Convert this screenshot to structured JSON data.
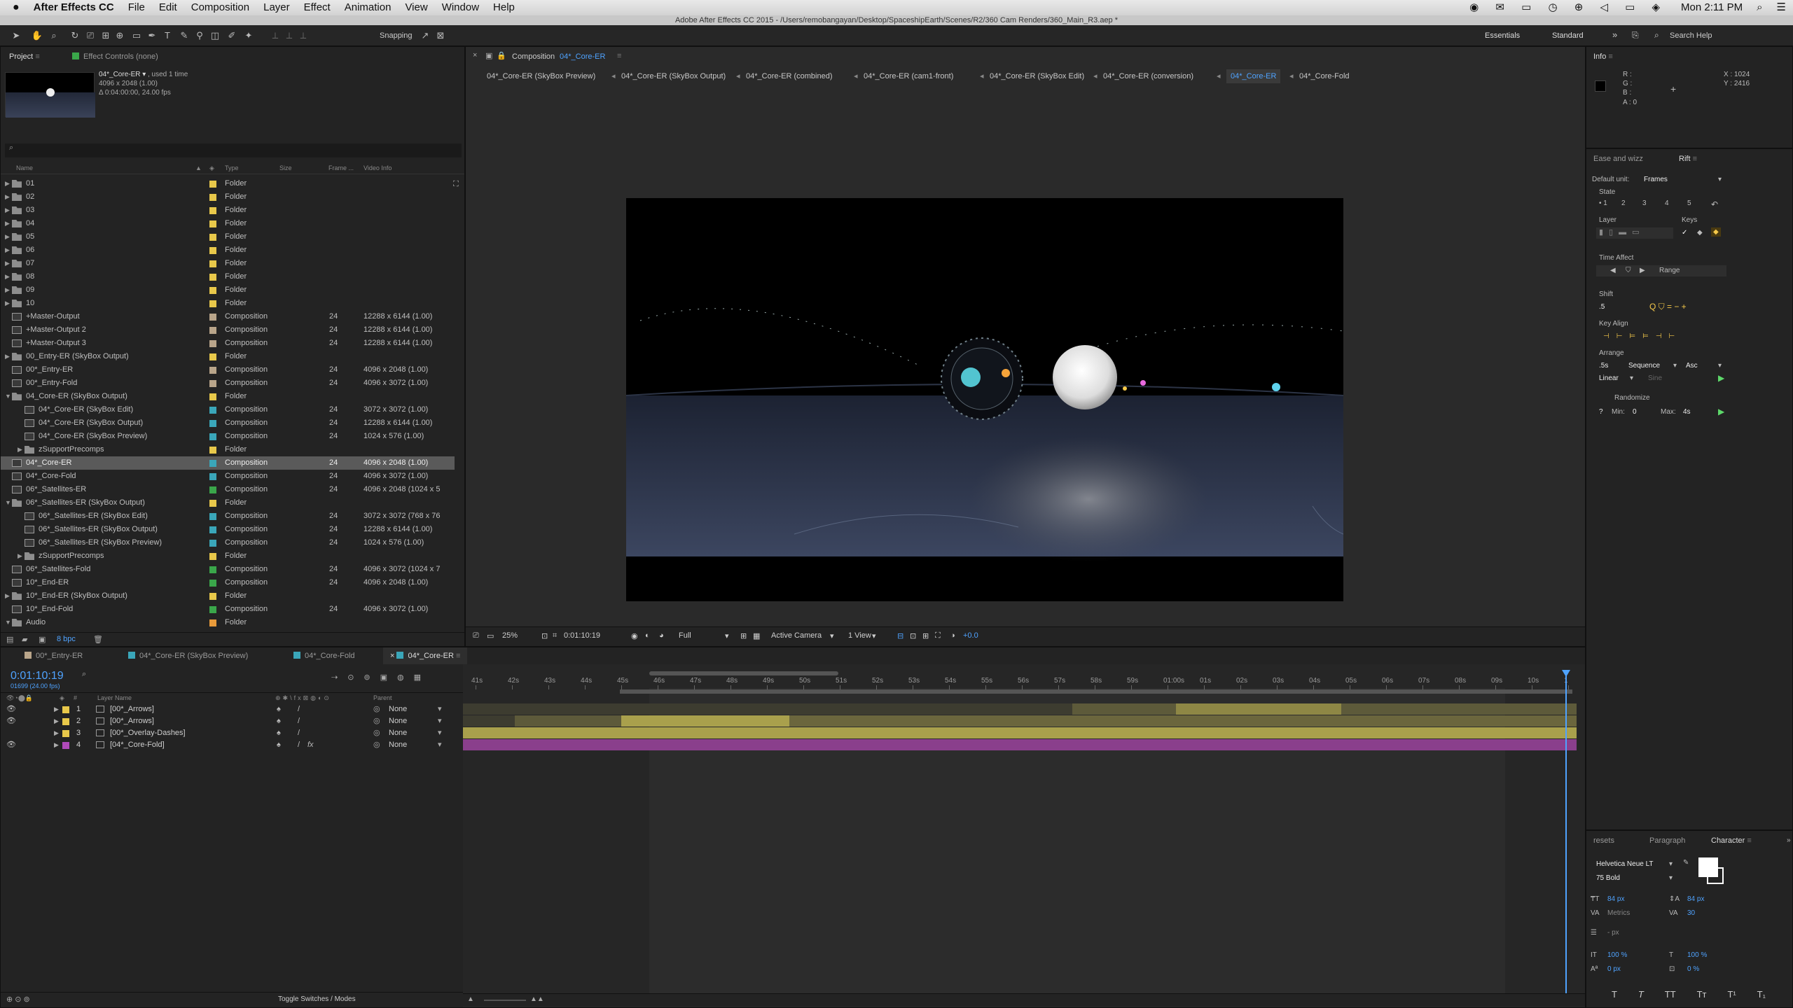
{
  "menubar": {
    "apple": "",
    "app": "After Effects CC",
    "items": [
      "File",
      "Edit",
      "Composition",
      "Layer",
      "Effect",
      "Animation",
      "View",
      "Window",
      "Help"
    ],
    "clock": "Mon 2:11 PM"
  },
  "title": "Adobe After Effects CC 2015 - /Users/remobangayan/Desktop/SpaceshipEarth/Scenes/R2/360 Cam Renders/360_Main_R3.aep *",
  "toolbar": {
    "snapping": "Snapping",
    "workspaces": [
      "Essentials",
      "Standard"
    ],
    "search": "Search Help"
  },
  "project": {
    "tab": "Project",
    "tab2": "Effect Controls (none)",
    "thumb_name": "04*_Core-ER ▾",
    "thumb_used": ", used 1 time",
    "thumb_size": "4096 x 2048 (1.00)",
    "thumb_dur": "Δ 0:04:00:00, 24.00 fps",
    "columns": [
      "Name",
      "Type",
      "Size",
      "Frame ...",
      "Video Info"
    ],
    "bpc": "8 bpc",
    "items": [
      {
        "tw": "▶",
        "name": "01",
        "type": "Folder",
        "fr": "",
        "vi": "",
        "color": "#e8c84a",
        "kind": "folder",
        "ind": 0
      },
      {
        "tw": "▶",
        "name": "02",
        "type": "Folder",
        "fr": "",
        "vi": "",
        "color": "#e8c84a",
        "kind": "folder",
        "ind": 0
      },
      {
        "tw": "▶",
        "name": "03",
        "type": "Folder",
        "fr": "",
        "vi": "",
        "color": "#e8c84a",
        "kind": "folder",
        "ind": 0
      },
      {
        "tw": "▶",
        "name": "04",
        "type": "Folder",
        "fr": "",
        "vi": "",
        "color": "#e8c84a",
        "kind": "folder",
        "ind": 0
      },
      {
        "tw": "▶",
        "name": "05",
        "type": "Folder",
        "fr": "",
        "vi": "",
        "color": "#e8c84a",
        "kind": "folder",
        "ind": 0
      },
      {
        "tw": "▶",
        "name": "06",
        "type": "Folder",
        "fr": "",
        "vi": "",
        "color": "#e8c84a",
        "kind": "folder",
        "ind": 0
      },
      {
        "tw": "▶",
        "name": "07",
        "type": "Folder",
        "fr": "",
        "vi": "",
        "color": "#e8c84a",
        "kind": "folder",
        "ind": 0
      },
      {
        "tw": "▶",
        "name": "08",
        "type": "Folder",
        "fr": "",
        "vi": "",
        "color": "#e8c84a",
        "kind": "folder",
        "ind": 0
      },
      {
        "tw": "▶",
        "name": "09",
        "type": "Folder",
        "fr": "",
        "vi": "",
        "color": "#e8c84a",
        "kind": "folder",
        "ind": 0
      },
      {
        "tw": "▶",
        "name": "10",
        "type": "Folder",
        "fr": "",
        "vi": "",
        "color": "#e8c84a",
        "kind": "folder",
        "ind": 0
      },
      {
        "tw": "",
        "name": "+Master-Output",
        "type": "Composition",
        "fr": "24",
        "vi": "12288 x 6144 (1.00)",
        "color": "#b9a58a",
        "kind": "comp",
        "ind": 0
      },
      {
        "tw": "",
        "name": "+Master-Output 2",
        "type": "Composition",
        "fr": "24",
        "vi": "12288 x 6144 (1.00)",
        "color": "#b9a58a",
        "kind": "comp",
        "ind": 0
      },
      {
        "tw": "",
        "name": "+Master-Output 3",
        "type": "Composition",
        "fr": "24",
        "vi": "12288 x 6144 (1.00)",
        "color": "#b9a58a",
        "kind": "comp",
        "ind": 0
      },
      {
        "tw": "▶",
        "name": "00_Entry-ER (SkyBox Output)",
        "type": "Folder",
        "fr": "",
        "vi": "",
        "color": "#e8c84a",
        "kind": "folder",
        "ind": 0
      },
      {
        "tw": "",
        "name": "00*_Entry-ER",
        "type": "Composition",
        "fr": "24",
        "vi": "4096 x 2048 (1.00)",
        "color": "#b9a58a",
        "kind": "comp",
        "ind": 0
      },
      {
        "tw": "",
        "name": "00*_Entry-Fold",
        "type": "Composition",
        "fr": "24",
        "vi": "4096 x 3072 (1.00)",
        "color": "#b9a58a",
        "kind": "comp",
        "ind": 0
      },
      {
        "tw": "▼",
        "name": "04_Core-ER (SkyBox Output)",
        "type": "Folder",
        "fr": "",
        "vi": "",
        "color": "#e8c84a",
        "kind": "folder",
        "ind": 0
      },
      {
        "tw": "",
        "name": "04*_Core-ER (SkyBox Edit)",
        "type": "Composition",
        "fr": "24",
        "vi": "3072 x 3072 (1.00)",
        "color": "#3aa6b9",
        "kind": "comp",
        "ind": 1
      },
      {
        "tw": "",
        "name": "04*_Core-ER (SkyBox Output)",
        "type": "Composition",
        "fr": "24",
        "vi": "12288 x 6144 (1.00)",
        "color": "#3aa6b9",
        "kind": "comp",
        "ind": 1
      },
      {
        "tw": "",
        "name": "04*_Core-ER (SkyBox Preview)",
        "type": "Composition",
        "fr": "24",
        "vi": "1024 x 576 (1.00)",
        "color": "#3aa6b9",
        "kind": "comp",
        "ind": 1
      },
      {
        "tw": "▶",
        "name": "zSupportPrecomps",
        "type": "Folder",
        "fr": "",
        "vi": "",
        "color": "#e8c84a",
        "kind": "folder",
        "ind": 1
      },
      {
        "tw": "",
        "name": "04*_Core-ER",
        "type": "Composition",
        "fr": "24",
        "vi": "4096 x 2048 (1.00)",
        "color": "#3aa6b9",
        "kind": "comp",
        "ind": 0,
        "sel": true
      },
      {
        "tw": "",
        "name": "04*_Core-Fold",
        "type": "Composition",
        "fr": "24",
        "vi": "4096 x 3072 (1.00)",
        "color": "#3aa6b9",
        "kind": "comp",
        "ind": 0
      },
      {
        "tw": "",
        "name": "06*_Satellites-ER",
        "type": "Composition",
        "fr": "24",
        "vi": "4096 x 2048 (1024 x 5",
        "color": "#3aa64a",
        "kind": "comp",
        "ind": 0
      },
      {
        "tw": "▼",
        "name": "06*_Satellites-ER (SkyBox Output)",
        "type": "Folder",
        "fr": "",
        "vi": "",
        "color": "#e8c84a",
        "kind": "folder",
        "ind": 0
      },
      {
        "tw": "",
        "name": "06*_Satellites-ER (SkyBox Edit)",
        "type": "Composition",
        "fr": "24",
        "vi": "3072 x 3072 (768 x 76",
        "color": "#3aa6b9",
        "kind": "comp",
        "ind": 1
      },
      {
        "tw": "",
        "name": "06*_Satellites-ER (SkyBox Output)",
        "type": "Composition",
        "fr": "24",
        "vi": "12288 x 6144 (1.00)",
        "color": "#3aa6b9",
        "kind": "comp",
        "ind": 1
      },
      {
        "tw": "",
        "name": "06*_Satellites-ER (SkyBox Preview)",
        "type": "Composition",
        "fr": "24",
        "vi": "1024 x 576 (1.00)",
        "color": "#3aa6b9",
        "kind": "comp",
        "ind": 1
      },
      {
        "tw": "▶",
        "name": "zSupportPrecomps",
        "type": "Folder",
        "fr": "",
        "vi": "",
        "color": "#e8c84a",
        "kind": "folder",
        "ind": 1
      },
      {
        "tw": "",
        "name": "06*_Satellites-Fold",
        "type": "Composition",
        "fr": "24",
        "vi": "4096 x 3072 (1024 x 7",
        "color": "#3aa64a",
        "kind": "comp",
        "ind": 0
      },
      {
        "tw": "",
        "name": "10*_End-ER",
        "type": "Composition",
        "fr": "24",
        "vi": "4096 x 2048 (1.00)",
        "color": "#3aa64a",
        "kind": "comp",
        "ind": 0
      },
      {
        "tw": "▶",
        "name": "10*_End-ER (SkyBox Output)",
        "type": "Folder",
        "fr": "",
        "vi": "",
        "color": "#e8c84a",
        "kind": "folder",
        "ind": 0
      },
      {
        "tw": "",
        "name": "10*_End-Fold",
        "type": "Composition",
        "fr": "24",
        "vi": "4096 x 3072 (1.00)",
        "color": "#3aa64a",
        "kind": "comp",
        "ind": 0
      },
      {
        "tw": "▼",
        "name": "Audio",
        "type": "Folder",
        "fr": "",
        "vi": "",
        "color": "#e89a3a",
        "kind": "folder",
        "ind": 0
      }
    ]
  },
  "composition": {
    "label": "Composition",
    "name": "04*_Core-ER",
    "tabs": [
      "04*_Core-ER (SkyBox Preview)",
      "04*_Core-ER (SkyBox Output)",
      "04*_Core-ER (combined)",
      "04*_Core-ER (cam1-front)",
      "04*_Core-ER (SkyBox Edit)",
      "04*_Core-ER (conversion)",
      "04*_Core-ER",
      "04*_Core-Fold"
    ],
    "active_index": 6,
    "viewer": {
      "zoom": "25%",
      "timecode": "0:01:10:19",
      "resolution": "Full",
      "camera": "Active Camera",
      "views": "1 View",
      "exposure": "+0.0"
    }
  },
  "timeline": {
    "tabs": [
      "00*_Entry-ER",
      "04*_Core-ER (SkyBox Preview)",
      "04*_Core-Fold",
      "04*_Core-ER"
    ],
    "tab_colors": [
      "#b9a58a",
      "#3aa6b9",
      "#3aa6b9",
      "#3aa6b9"
    ],
    "timecode": "0:01:10:19",
    "frames": "01699 (24.00 fps)",
    "col_layer": "Layer Name",
    "col_parent": "Parent",
    "toggle": "Toggle Switches / Modes",
    "ruler": [
      "41s",
      "42s",
      "43s",
      "44s",
      "45s",
      "46s",
      "47s",
      "48s",
      "49s",
      "50s",
      "51s",
      "52s",
      "53s",
      "54s",
      "55s",
      "56s",
      "57s",
      "58s",
      "59s",
      "01:00s",
      "01s",
      "02s",
      "03s",
      "04s",
      "05s",
      "06s",
      "07s",
      "08s",
      "09s",
      "10s",
      "1"
    ],
    "layers": [
      {
        "num": "1",
        "name": "[00*_Arrows]",
        "parent": "None",
        "color": "#e8c84a"
      },
      {
        "num": "2",
        "name": "[00*_Arrows]",
        "parent": "None",
        "color": "#e8c84a"
      },
      {
        "num": "3",
        "name": "[00*_Overlay-Dashes]",
        "parent": "None",
        "color": "#e8c84a"
      },
      {
        "num": "4",
        "name": "[04*_Core-Fold]",
        "parent": "None",
        "color": "#b04ab9"
      }
    ]
  },
  "info": {
    "tab": "Info",
    "r": "R :",
    "g": "G :",
    "b": "B :",
    "a": "A : 0",
    "x": "X : 1024",
    "y": "Y : 2416"
  },
  "rift": {
    "tabs": [
      "Ease and wizz",
      "Rift"
    ],
    "default_unit_label": "Default unit:",
    "default_unit": "Frames",
    "state": "State",
    "states": [
      "1",
      "2",
      "3",
      "4",
      "5"
    ],
    "layer": "Layer",
    "keys": "Keys",
    "time_affect": "Time Affect",
    "range": "Range",
    "shift": "Shift",
    "shift_val": ".5",
    "key_align": "Key Align",
    "arrange": "Arrange",
    "arrange_val": ".5s",
    "sequence": "Sequence",
    "asc": "Asc",
    "linear": "Linear",
    "sine": "Sine",
    "randomize": "Randomize",
    "q": "?",
    "min_label": "Min:",
    "min": "0",
    "max_label": "Max:",
    "max": "4s"
  },
  "character": {
    "tabs": [
      "resets",
      "Paragraph",
      "Character"
    ],
    "font": "Helvetica Neue LT",
    "style": "75 Bold",
    "size": "84 px",
    "leading": "84 px",
    "kerning": "Metrics",
    "tracking": "30",
    "stroke": "- px",
    "vscale": "100 %",
    "hscale": "100 %",
    "baseline": "0 px",
    "tsume": "0 %",
    "styles": [
      "T",
      "T",
      "TT",
      "Tт",
      "T¹",
      "T₁"
    ]
  }
}
